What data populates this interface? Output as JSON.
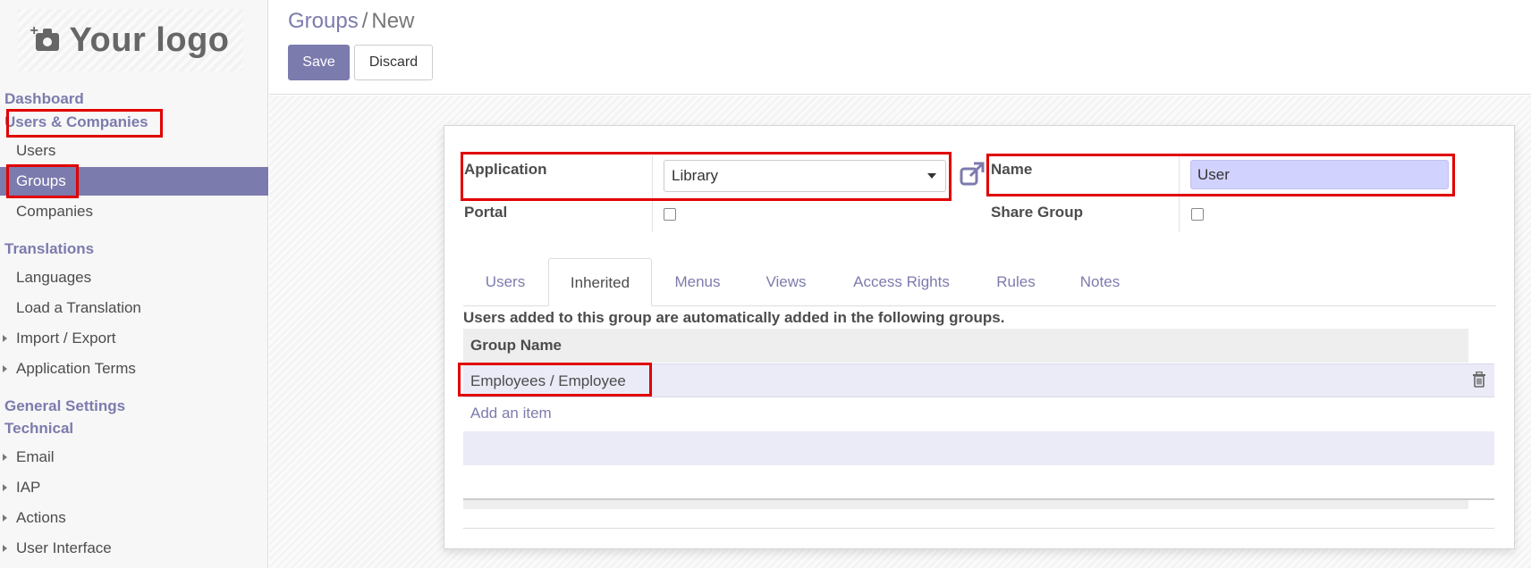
{
  "logo": {
    "text": "Your logo",
    "icon": "camera-plus-icon"
  },
  "sidebar": {
    "sections": [
      {
        "label": "Dashboard"
      },
      {
        "label": "Users & Companies"
      },
      {
        "label": "Translations"
      },
      {
        "label": "General Settings"
      },
      {
        "label": "Technical"
      }
    ],
    "items": [
      {
        "label": "Users"
      },
      {
        "label": "Groups",
        "active": true
      },
      {
        "label": "Companies"
      },
      {
        "label": "Languages"
      },
      {
        "label": "Load a Translation"
      },
      {
        "label": "Import / Export",
        "expandable": true
      },
      {
        "label": "Application Terms",
        "expandable": true
      },
      {
        "label": "Email",
        "expandable": true
      },
      {
        "label": "IAP",
        "expandable": true
      },
      {
        "label": "Actions",
        "expandable": true
      },
      {
        "label": "User Interface",
        "expandable": true
      }
    ]
  },
  "breadcrumb": {
    "parent": "Groups",
    "separator": "/",
    "current": "New"
  },
  "toolbar": {
    "save_label": "Save",
    "discard_label": "Discard"
  },
  "form": {
    "application": {
      "label": "Application",
      "value": "Library"
    },
    "name": {
      "label": "Name",
      "value": "User"
    },
    "portal": {
      "label": "Portal",
      "checked": false
    },
    "share_group": {
      "label": "Share Group",
      "checked": false
    }
  },
  "tabs": [
    {
      "label": "Users"
    },
    {
      "label": "Inherited",
      "active": true
    },
    {
      "label": "Menus"
    },
    {
      "label": "Views"
    },
    {
      "label": "Access Rights"
    },
    {
      "label": "Rules"
    },
    {
      "label": "Notes"
    }
  ],
  "inherited": {
    "info": "Users added to this group are automatically added in the following groups.",
    "column_header": "Group Name",
    "rows": [
      {
        "group_name": "Employees / Employee"
      }
    ],
    "add_item_label": "Add an item"
  },
  "colors": {
    "accent": "#7c7bad",
    "highlight": "#e10000",
    "name_field_bg": "#d2d2ff"
  }
}
